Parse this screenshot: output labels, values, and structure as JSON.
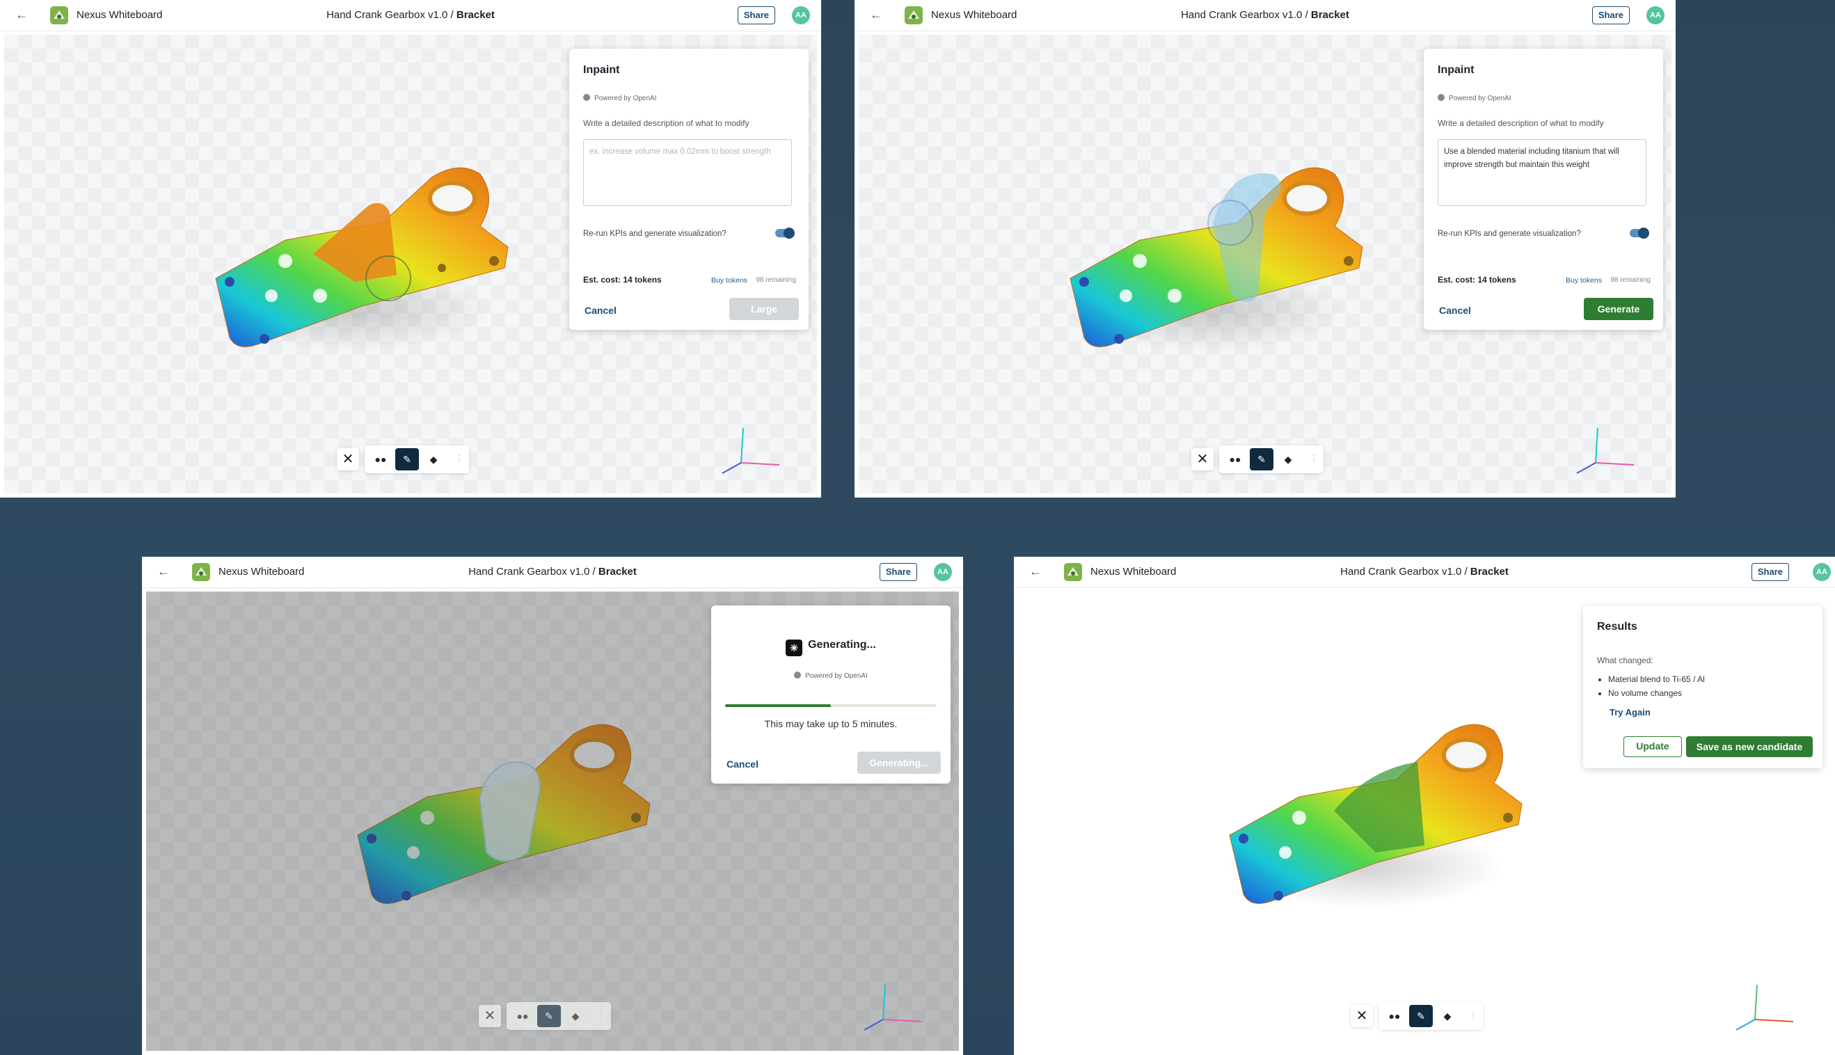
{
  "app": {
    "name": "Nexus Whiteboard",
    "project": "Hand Crank Gearbox v1.0",
    "separator": " / ",
    "part": "Bracket",
    "share_label": "Share",
    "avatar_initials": "AA",
    "back_icon": "arrow-left-icon"
  },
  "inpaint": {
    "title": "Inpaint",
    "powered_by": "Powered by OpenAI",
    "instruction": "Write a detailed description of what to modify",
    "placeholder": "ex. increase volume max 0.02mm to boost strength",
    "prompt_value": "Use a blended material including titanium that will improve strength but maintain this weight",
    "rerun_label": "Re-run KPIs and generate visualization?",
    "rerun_enabled": true,
    "est_cost": "Est. cost: 14 tokens",
    "buy_tokens": "Buy tokens",
    "remaining": "98 remaining",
    "cancel": "Cancel",
    "brush_size_label": "Large",
    "generate": "Generate"
  },
  "generating": {
    "title": "Generating...",
    "powered_by": "Powered by OpenAI",
    "progress": 0.5,
    "note": "This may take up to 5 minutes.",
    "cancel": "Cancel",
    "button": "Generating..."
  },
  "results": {
    "title": "Results",
    "what_changed_label": "What changed:",
    "changes": [
      "Material blend to Ti-65 / Al",
      "No volume changes"
    ],
    "try_again": "Try Again",
    "update": "Update",
    "save_candidate": "Save as new candidate"
  },
  "toolbar": {
    "close_icon": "close-icon",
    "tools": [
      "brush-size-icon",
      "brush-icon",
      "eraser-icon"
    ],
    "active_tool": "brush-icon",
    "grip_icon": "grip-icon"
  },
  "colors": {
    "accent_green": "#2e7d32",
    "navy": "#1d4b73",
    "avatar": "#55c4a0",
    "toolbar_active": "#0f2a3f"
  }
}
